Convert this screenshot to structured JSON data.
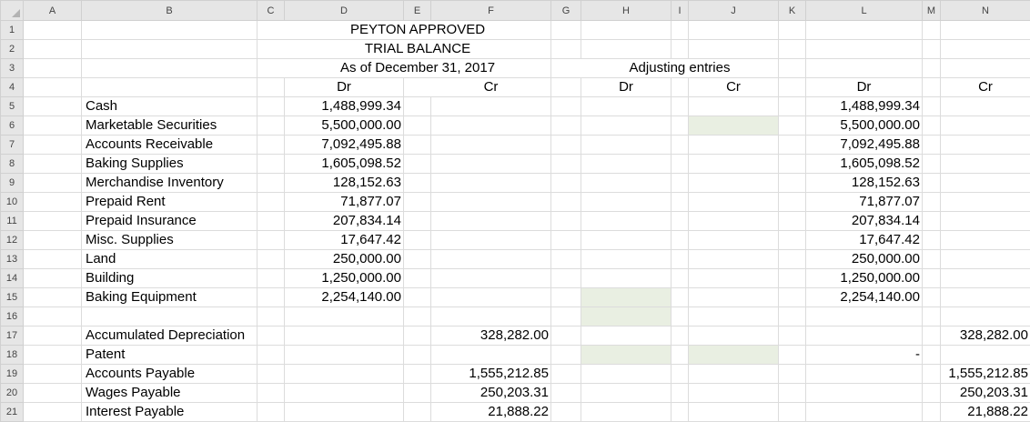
{
  "columns": [
    "A",
    "B",
    "C",
    "D",
    "E",
    "F",
    "G",
    "H",
    "I",
    "J",
    "K",
    "L",
    "M",
    "N"
  ],
  "rows": [
    "1",
    "2",
    "3",
    "4",
    "5",
    "6",
    "7",
    "8",
    "9",
    "10",
    "11",
    "12",
    "13",
    "14",
    "15",
    "16",
    "17",
    "18",
    "19",
    "20",
    "21"
  ],
  "title": {
    "company": "PEYTON APPROVED",
    "report": "TRIAL BALANCE",
    "date": "As of December 31, 2017",
    "adjusting": "Adjusting entries"
  },
  "headers": {
    "tb_dr": "Dr",
    "tb_cr": "Cr",
    "adj_dr": "Dr",
    "adj_cr": "Cr",
    "atb_dr": "Dr",
    "atb_cr": "Cr"
  },
  "accounts": [
    {
      "name": "Cash",
      "dr": "1,488,999.34",
      "cr": "",
      "adj_dr": "",
      "adj_cr": "",
      "atb_dr": "1,488,999.34",
      "atb_cr": ""
    },
    {
      "name": "Marketable Securities",
      "dr": "5,500,000.00",
      "cr": "",
      "adj_dr": "",
      "adj_cr": "",
      "atb_dr": "5,500,000.00",
      "atb_cr": ""
    },
    {
      "name": "Accounts Receivable",
      "dr": "7,092,495.88",
      "cr": "",
      "adj_dr": "",
      "adj_cr": "",
      "atb_dr": "7,092,495.88",
      "atb_cr": ""
    },
    {
      "name": "Baking Supplies",
      "dr": "1,605,098.52",
      "cr": "",
      "adj_dr": "",
      "adj_cr": "",
      "atb_dr": "1,605,098.52",
      "atb_cr": ""
    },
    {
      "name": "Merchandise Inventory",
      "dr": "128,152.63",
      "cr": "",
      "adj_dr": "",
      "adj_cr": "",
      "atb_dr": "128,152.63",
      "atb_cr": ""
    },
    {
      "name": "Prepaid Rent",
      "dr": "71,877.07",
      "cr": "",
      "adj_dr": "",
      "adj_cr": "",
      "atb_dr": "71,877.07",
      "atb_cr": ""
    },
    {
      "name": "Prepaid Insurance",
      "dr": "207,834.14",
      "cr": "",
      "adj_dr": "",
      "adj_cr": "",
      "atb_dr": "207,834.14",
      "atb_cr": ""
    },
    {
      "name": "Misc. Supplies",
      "dr": "17,647.42",
      "cr": "",
      "adj_dr": "",
      "adj_cr": "",
      "atb_dr": "17,647.42",
      "atb_cr": ""
    },
    {
      "name": "Land",
      "dr": "250,000.00",
      "cr": "",
      "adj_dr": "",
      "adj_cr": "",
      "atb_dr": "250,000.00",
      "atb_cr": ""
    },
    {
      "name": "Building",
      "dr": "1,250,000.00",
      "cr": "",
      "adj_dr": "",
      "adj_cr": "",
      "atb_dr": "1,250,000.00",
      "atb_cr": ""
    },
    {
      "name": "Baking Equipment",
      "dr": "2,254,140.00",
      "cr": "",
      "adj_dr": "",
      "adj_cr": "",
      "atb_dr": "2,254,140.00",
      "atb_cr": ""
    },
    {
      "name": "",
      "dr": "",
      "cr": "",
      "adj_dr": "",
      "adj_cr": "",
      "atb_dr": "",
      "atb_cr": ""
    },
    {
      "name": "Accumulated Depreciation",
      "dr": "",
      "cr": "328,282.00",
      "adj_dr": "",
      "adj_cr": "",
      "atb_dr": "",
      "atb_cr": "328,282.00"
    },
    {
      "name": "Patent",
      "dr": "",
      "cr": "",
      "adj_dr": "",
      "adj_cr": "",
      "atb_dr": "-",
      "atb_cr": ""
    },
    {
      "name": "Accounts Payable",
      "dr": "",
      "cr": "1,555,212.85",
      "adj_dr": "",
      "adj_cr": "",
      "atb_dr": "",
      "atb_cr": "1,555,212.85"
    },
    {
      "name": "Wages Payable",
      "dr": "",
      "cr": "250,203.31",
      "adj_dr": "",
      "adj_cr": "",
      "atb_dr": "",
      "atb_cr": "250,203.31"
    },
    {
      "name": "Interest Payable",
      "dr": "",
      "cr": "21,888.22",
      "adj_dr": "",
      "adj_cr": "",
      "atb_dr": "",
      "atb_cr": "21,888.22"
    }
  ],
  "colors": {
    "input_fill": "#e9efe2",
    "header_bg": "#e6e6e6",
    "gridline": "#dcdcdc"
  }
}
